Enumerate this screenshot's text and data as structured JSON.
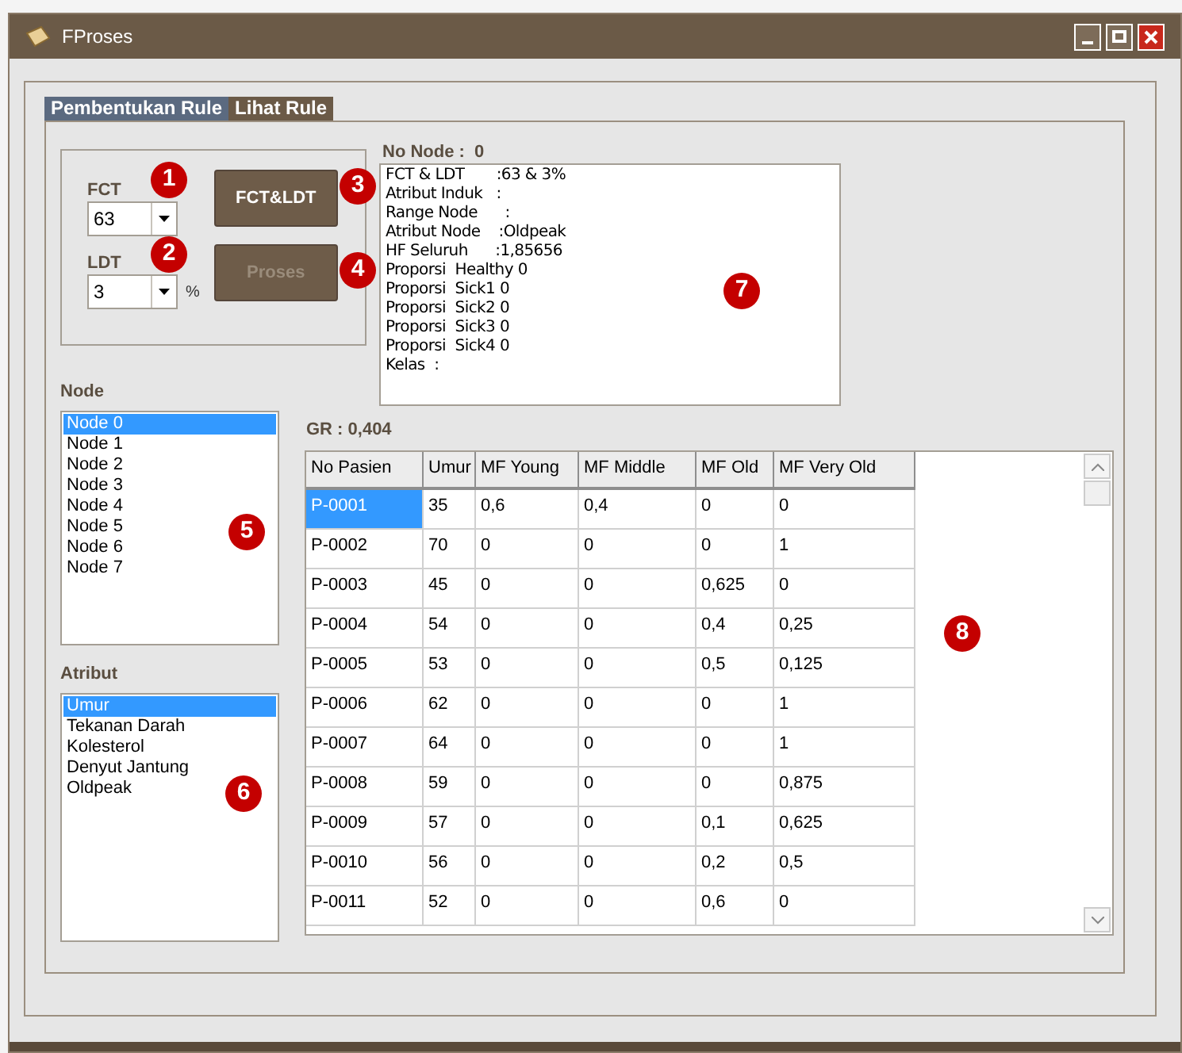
{
  "window": {
    "title": "FProses"
  },
  "tabs": [
    {
      "label": "Pembentukan Rule",
      "selected": true
    },
    {
      "label": "Lihat Rule",
      "selected": false
    }
  ],
  "settings": {
    "fct": {
      "label": "FCT",
      "value": "63"
    },
    "ldt": {
      "label": "LDT",
      "value": "3",
      "unit": "%"
    },
    "buttons": [
      {
        "label": "FCT&LDT",
        "disabled": false
      },
      {
        "label": "Proses",
        "disabled": true
      }
    ]
  },
  "node_info": {
    "title": "No Node :  0",
    "lines": [
      "FCT & LDT       :63 & 3%",
      "Atribut Induk   :",
      "Range Node      :",
      "Atribut Node    :Oldpeak",
      "HF Seluruh      :1,85656",
      "Proporsi  Healthy 0",
      "Proporsi  Sick1 0",
      "Proporsi  Sick2 0",
      "Proporsi  Sick3 0",
      "Proporsi  Sick4 0",
      "Kelas  :"
    ]
  },
  "node_list": {
    "label": "Node",
    "items": [
      {
        "text": "Node 0",
        "selected": true
      },
      {
        "text": "Node 1",
        "selected": false
      },
      {
        "text": "Node 2",
        "selected": false
      },
      {
        "text": "Node 3",
        "selected": false
      },
      {
        "text": "Node 4",
        "selected": false
      },
      {
        "text": "Node 5",
        "selected": false
      },
      {
        "text": "Node 6",
        "selected": false
      },
      {
        "text": "Node 7",
        "selected": false
      }
    ]
  },
  "attribute_list": {
    "label": "Atribut",
    "items": [
      {
        "text": "Umur",
        "selected": true
      },
      {
        "text": "Tekanan Darah",
        "selected": false
      },
      {
        "text": "Kolesterol",
        "selected": false
      },
      {
        "text": "Denyut Jantung",
        "selected": false
      },
      {
        "text": "Oldpeak",
        "selected": false
      }
    ]
  },
  "gr": "GR : 0,404",
  "table": {
    "columns": [
      "No Pasien",
      "Umur",
      "MF Young",
      "MF Middle",
      "MF Old",
      "MF Very Old"
    ],
    "rows": [
      {
        "cells": [
          "P-0001",
          "35",
          "0,6",
          "0,4",
          "0",
          "0"
        ],
        "selected": true
      },
      {
        "cells": [
          "P-0002",
          "70",
          "0",
          "0",
          "0",
          "1"
        ],
        "selected": false
      },
      {
        "cells": [
          "P-0003",
          "45",
          "0",
          "0",
          "0,625",
          "0"
        ],
        "selected": false
      },
      {
        "cells": [
          "P-0004",
          "54",
          "0",
          "0",
          "0,4",
          "0,25"
        ],
        "selected": false
      },
      {
        "cells": [
          "P-0005",
          "53",
          "0",
          "0",
          "0,5",
          "0,125"
        ],
        "selected": false
      },
      {
        "cells": [
          "P-0006",
          "62",
          "0",
          "0",
          "0",
          "1"
        ],
        "selected": false
      },
      {
        "cells": [
          "P-0007",
          "64",
          "0",
          "0",
          "0",
          "1"
        ],
        "selected": false
      },
      {
        "cells": [
          "P-0008",
          "59",
          "0",
          "0",
          "0",
          "0,875"
        ],
        "selected": false
      },
      {
        "cells": [
          "P-0009",
          "57",
          "0",
          "0",
          "0,1",
          "0,625"
        ],
        "selected": false
      },
      {
        "cells": [
          "P-0010",
          "56",
          "0",
          "0",
          "0,2",
          "0,5"
        ],
        "selected": false
      },
      {
        "cells": [
          "P-0011",
          "52",
          "0",
          "0",
          "0,6",
          "0"
        ],
        "selected": false
      }
    ]
  },
  "markers": [
    "1",
    "2",
    "3",
    "4",
    "5",
    "6",
    "7",
    "8"
  ]
}
